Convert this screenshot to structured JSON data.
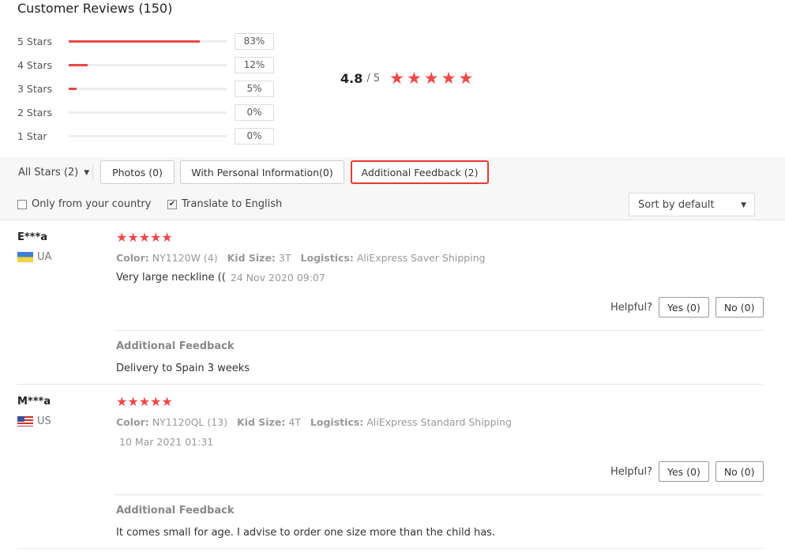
{
  "header": {
    "title": "Customer Reviews (150)"
  },
  "summary": {
    "rows": [
      {
        "label": "5 Stars",
        "percent": "83%",
        "fill": 0.83
      },
      {
        "label": "4 Stars",
        "percent": "12%",
        "fill": 0.12
      },
      {
        "label": "3 Stars",
        "percent": "5%",
        "fill": 0.05
      },
      {
        "label": "2 Stars",
        "percent": "0%",
        "fill": 0
      },
      {
        "label": "1 Star",
        "percent": "0%",
        "fill": 0
      }
    ],
    "score": "4.8",
    "out_of": "/ 5",
    "star_glyph": "★"
  },
  "filters": {
    "all_stars": "All Stars (2)",
    "photos": "Photos (0)",
    "personal": "With Personal Information(0)",
    "additional": "Additional Feedback (2)",
    "only_country": "Only from your country",
    "translate": "Translate to English",
    "sort": "Sort by default",
    "chevron": "⌄"
  },
  "reviews": [
    {
      "name": "E***a",
      "country": "UA",
      "color_label": "Color:",
      "color": "NY1120W (4)",
      "size_label": "Kid Size:",
      "size": "3T",
      "logistics_label": "Logistics:",
      "logistics": "AliExpress Saver Shipping",
      "text": "Very large neckline ((",
      "date": "24 Nov 2020 09:07",
      "helpful": "Helpful?",
      "yes": "Yes (0)",
      "no": "No (0)",
      "additional_title": "Additional Feedback",
      "additional_text": "Delivery to Spain 3 weeks"
    },
    {
      "name": "M***a",
      "country": "US",
      "color_label": "Color:",
      "color": "NY1120QL (13)",
      "size_label": "Kid Size:",
      "size": "4T",
      "logistics_label": "Logistics:",
      "logistics": "AliExpress Standard Shipping",
      "text": "",
      "date": "10 Mar 2021 01:31",
      "helpful": "Helpful?",
      "yes": "Yes (0)",
      "no": "No (0)",
      "additional_title": "Additional Feedback",
      "additional_text": "It comes small for age. I advise to order one size more than the child has."
    }
  ],
  "colors": {
    "accent": "#e84848",
    "star": "#f24848",
    "active_border": "#e53935"
  }
}
